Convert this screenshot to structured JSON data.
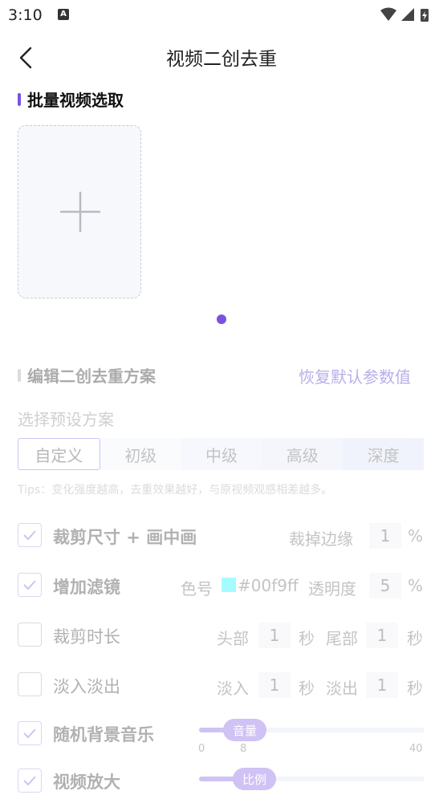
{
  "status": {
    "time": "3:10",
    "notification_letter": "A"
  },
  "header": {
    "title": "视频二创去重"
  },
  "section1": {
    "title": "批量视频选取"
  },
  "section2": {
    "title": "编辑二创去重方案",
    "reset_label": "恢复默认参数值"
  },
  "preset": {
    "label": "选择预设方案",
    "tabs": [
      "自定义",
      "初级",
      "中级",
      "高级",
      "深度"
    ],
    "selected": "自定义",
    "tips": "Tips：变化强度越高，去重效果越好，与原视频观感相差越多。"
  },
  "options": {
    "crop": {
      "label": "裁剪尺寸 + 画中画",
      "checked": true,
      "param_label": "裁掉边缘",
      "value": "1",
      "unit": "%"
    },
    "filter": {
      "label": "增加滤镜",
      "checked": true,
      "color_label": "色号",
      "color_value": "#00f9ff",
      "color_text": "#00f9ff",
      "opacity_label": "透明度",
      "opacity_value": "5",
      "unit": "%"
    },
    "trim": {
      "label": "裁剪时长",
      "checked": false,
      "head_label": "头部",
      "head_value": "1",
      "head_unit": "秒",
      "tail_label": "尾部",
      "tail_value": "1",
      "tail_unit": "秒"
    },
    "fade": {
      "label": "淡入淡出",
      "checked": false,
      "in_label": "淡入",
      "in_value": "1",
      "in_unit": "秒",
      "out_label": "淡出",
      "out_value": "1",
      "out_unit": "秒"
    },
    "music": {
      "label": "随机背景音乐",
      "checked": true,
      "slider_label": "音量",
      "min": "0",
      "value": "8",
      "max": "40"
    },
    "zoom": {
      "label": "视频放大",
      "checked": true,
      "slider_label": "比例"
    }
  }
}
